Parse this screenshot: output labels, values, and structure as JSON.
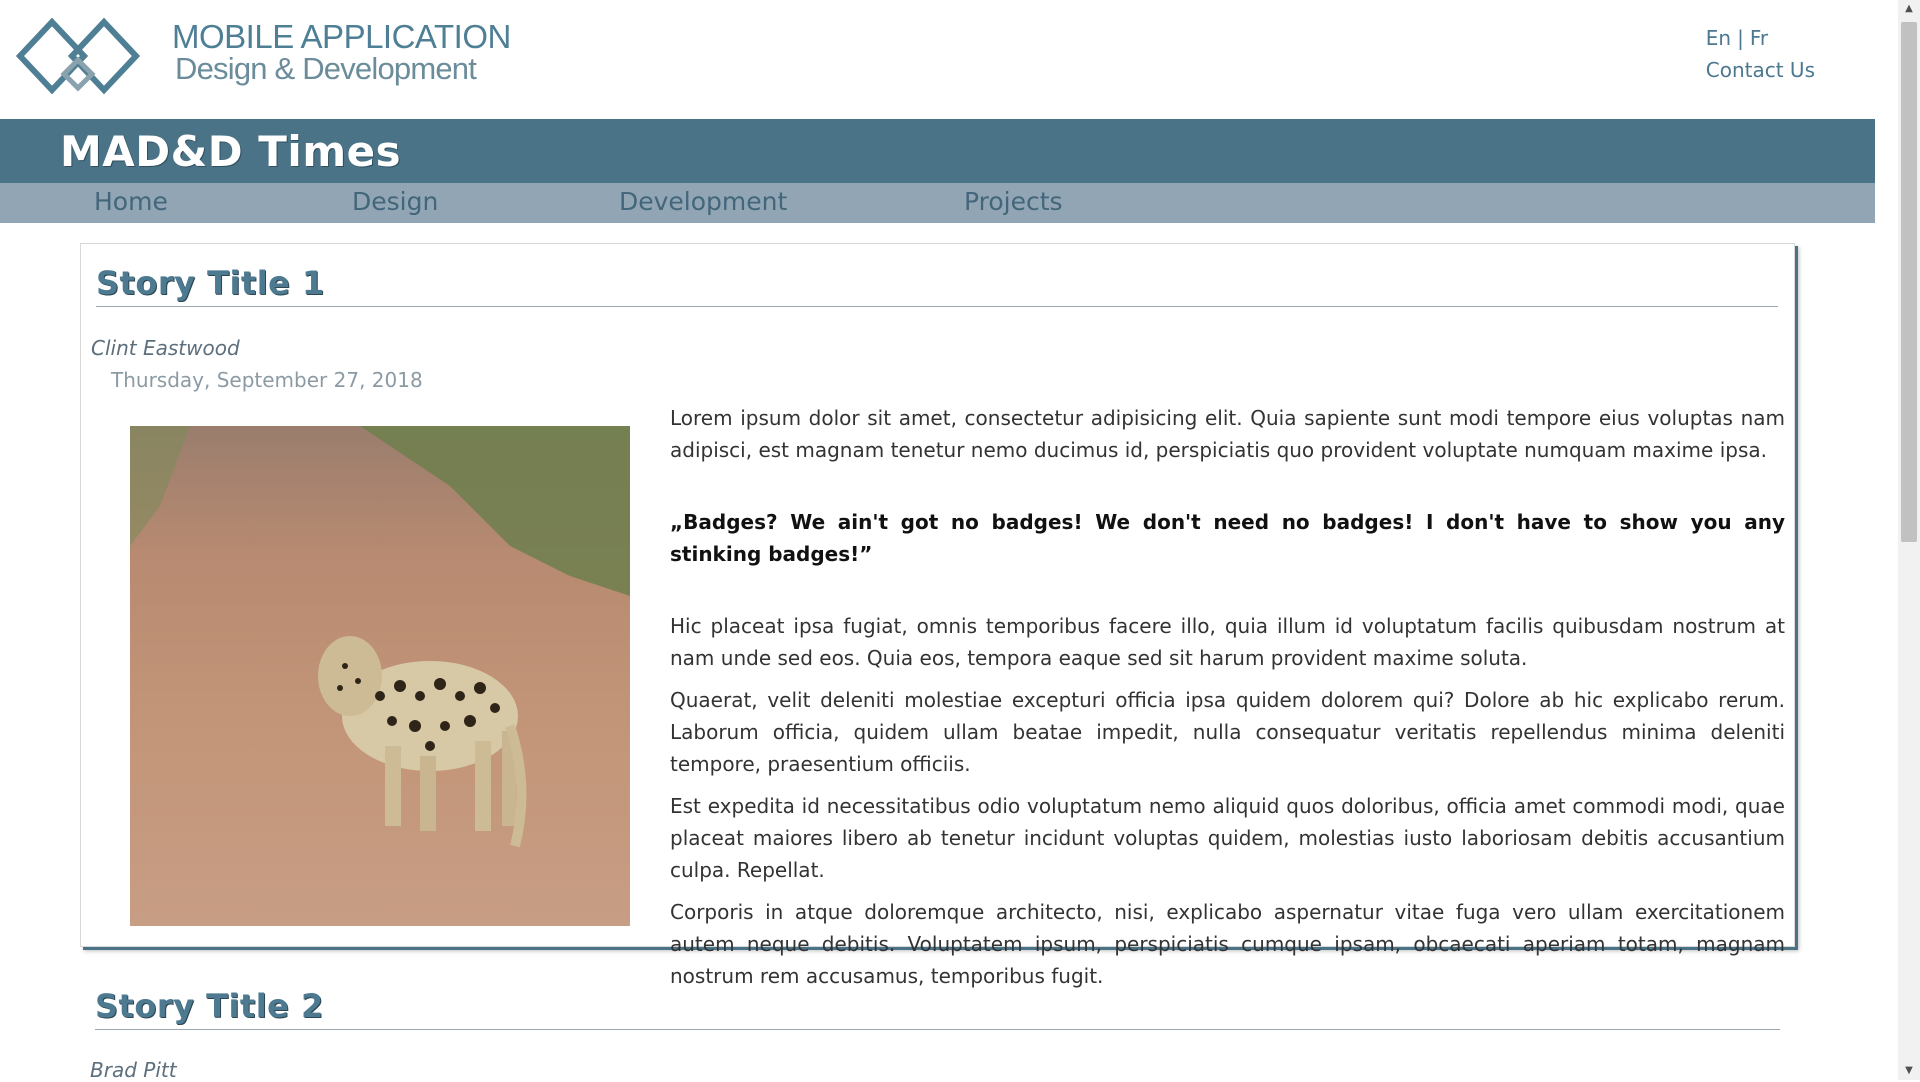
{
  "header": {
    "logo_line1": "MOBILE APPLICATION",
    "logo_line2": "Design & Development",
    "lang_en": "En",
    "lang_sep": "|",
    "lang_fr": "Fr",
    "contact": "Contact Us"
  },
  "band": {
    "title": "MAD&D Times"
  },
  "nav": {
    "items": [
      "Home",
      "Design",
      "Development",
      "Projects"
    ]
  },
  "stories": [
    {
      "title": "Story Title 1",
      "author": "Clint Eastwood",
      "date": "Thursday, September 27, 2018",
      "paragraphs": [
        "Lorem ipsum dolor sit amet, consectetur adipisicing elit. Quia sapiente sunt modi tempore eius voluptas nam adipisci, est magnam tenetur nemo ducimus id, perspiciatis quo provident voluptate numquam maxime ipsa.",
        "„Badges? We ain't got no badges! We don't need no badges! I don't have to show you any stinking badges!”",
        "Hic placeat ipsa fugiat, omnis temporibus facere illo, quia illum id voluptatum facilis quibusdam nostrum at nam unde sed eos. Quia eos, tempora eaque sed sit harum provident maxime soluta.",
        "Quaerat, velit deleniti molestiae excepturi officia ipsa quidem dolorem qui? Dolore ab hic explicabo rerum. Laborum officia, quidem ullam beatae impedit, nulla consequatur veritatis repellendus minima deleniti tempore, praesentium officiis.",
        "Est expedita id necessitatibus odio voluptatum nemo aliquid quos doloribus, officia amet commodi modi, quae placeat maiores libero ab tenetur incidunt voluptas quidem, molestias iusto laboriosam debitis accusantium culpa. Repellat.",
        "Corporis in atque doloremque architecto, nisi, explicabo aspernatur vitae fuga vero ullam exercitationem autem neque debitis. Voluptatem ipsum, perspiciatis cumque ipsam, obcaecati aperiam totam, magnam nostrum rem accusamus, temporibus fugit."
      ]
    },
    {
      "title": "Story Title 2",
      "author": "Brad Pitt"
    }
  ],
  "colors": {
    "brand": "#4a7387",
    "nav_bg": "#92a5b4",
    "nav_text": "#42667a",
    "link": "#4c7890"
  },
  "icons": {
    "logo": "interlocking-diamonds-logo",
    "scroll_up": "scroll-up-arrow-icon",
    "scroll_down": "scroll-down-arrow-icon"
  }
}
